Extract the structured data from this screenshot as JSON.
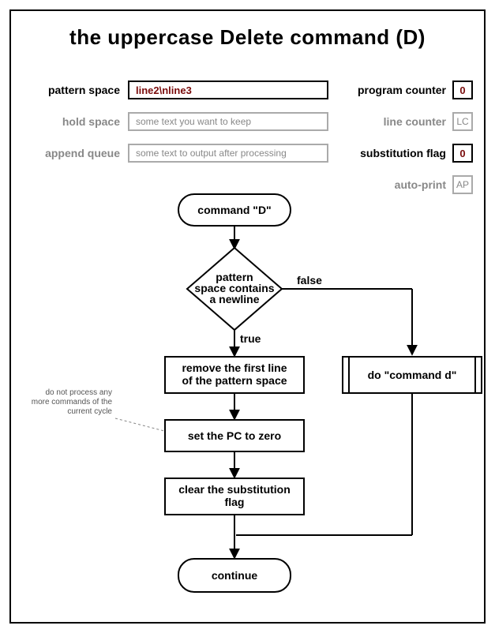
{
  "title": "the uppercase Delete command (D)",
  "state": {
    "pattern_space_label": "pattern space",
    "pattern_space_value": "line2\\nline3",
    "hold_space_label": "hold space",
    "hold_space_value": "some text you want to keep",
    "append_queue_label": "append queue",
    "append_queue_value": "some text to output after processing",
    "program_counter_label": "program counter",
    "program_counter_value": "0",
    "line_counter_label": "line counter",
    "line_counter_value": "LC",
    "substitution_flag_label": "substitution flag",
    "substitution_flag_value": "0",
    "auto_print_label": "auto-print",
    "auto_print_value": "AP"
  },
  "flow": {
    "start": "command \"D\"",
    "decision_l1": "pattern",
    "decision_l2": "space contains",
    "decision_l3": "a newline",
    "true_label": "true",
    "false_label": "false",
    "step1_l1": "remove the first line",
    "step1_l2": "of the pattern space",
    "step2": "set the PC to zero",
    "step3_l1": "clear the substitution",
    "step3_l2": "flag",
    "right": "do \"command d\"",
    "end": "continue",
    "note_l1": "do not process any",
    "note_l2": "more commands of the",
    "note_l3": "current cycle"
  }
}
